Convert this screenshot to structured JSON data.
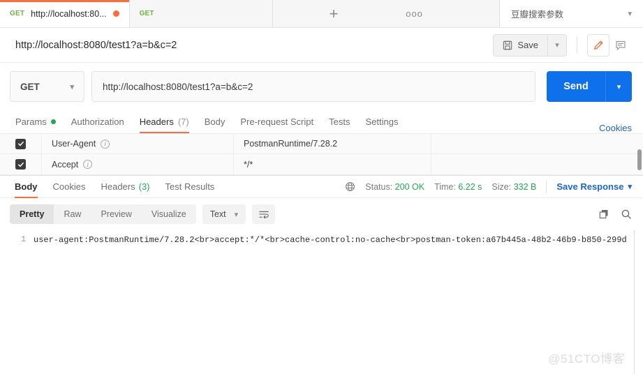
{
  "tabstrip": {
    "tabs": [
      {
        "method": "GET",
        "title": "http://localhost:80...",
        "unsaved": true
      },
      {
        "method": "GET",
        "title": "",
        "unsaved": false
      }
    ],
    "new_tab_label": "+",
    "more_label": "ooo",
    "environment": "豆瓣搜索参数"
  },
  "namerow": {
    "request_name": "http://localhost:8080/test1?a=b&c=2",
    "save_label": "Save"
  },
  "urlrow": {
    "method": "GET",
    "url": "http://localhost:8080/test1?a=b&c=2",
    "send_label": "Send"
  },
  "request_tabs": {
    "items": [
      {
        "label": "Params",
        "dot": true
      },
      {
        "label": "Authorization",
        "dot": false
      },
      {
        "label": "Headers",
        "count": "(7)",
        "dot": false
      },
      {
        "label": "Body",
        "dot": false
      },
      {
        "label": "Pre-request Script",
        "dot": false
      },
      {
        "label": "Tests",
        "dot": false
      },
      {
        "label": "Settings",
        "dot": false
      }
    ],
    "active": "Headers",
    "cookies_label": "Cookies"
  },
  "headers_table": {
    "rows": [
      {
        "checked": true,
        "key": "User-Agent",
        "value": "PostmanRuntime/7.28.2"
      },
      {
        "checked": true,
        "key": "Accept",
        "value": "*/*"
      }
    ]
  },
  "response_bar": {
    "tabs": [
      {
        "label": "Body"
      },
      {
        "label": "Cookies"
      },
      {
        "label": "Headers",
        "count": "(3)"
      },
      {
        "label": "Test Results"
      }
    ],
    "active": "Body",
    "status_label": "Status:",
    "status_value": "200 OK",
    "time_label": "Time:",
    "time_value": "6.22 s",
    "size_label": "Size:",
    "size_value": "332 B",
    "save_response_label": "Save Response"
  },
  "format_bar": {
    "views": [
      "Pretty",
      "Raw",
      "Preview",
      "Visualize"
    ],
    "active_view": "Pretty",
    "type": "Text"
  },
  "body": {
    "line_number": "1",
    "content": "user-agent:PostmanRuntime/7.28.2<br>accept:*/*<br>cache-control:no-cache<br>postman-token:a67b445a-48b2-46b9-b850-299d"
  },
  "watermark": "@51CTO博客",
  "colors": {
    "accent_orange": "#ff6c37",
    "send_blue": "#0e71eb",
    "link_blue": "#1a64d6",
    "status_green": "#1faa52",
    "method_green": "#6cb33f"
  }
}
